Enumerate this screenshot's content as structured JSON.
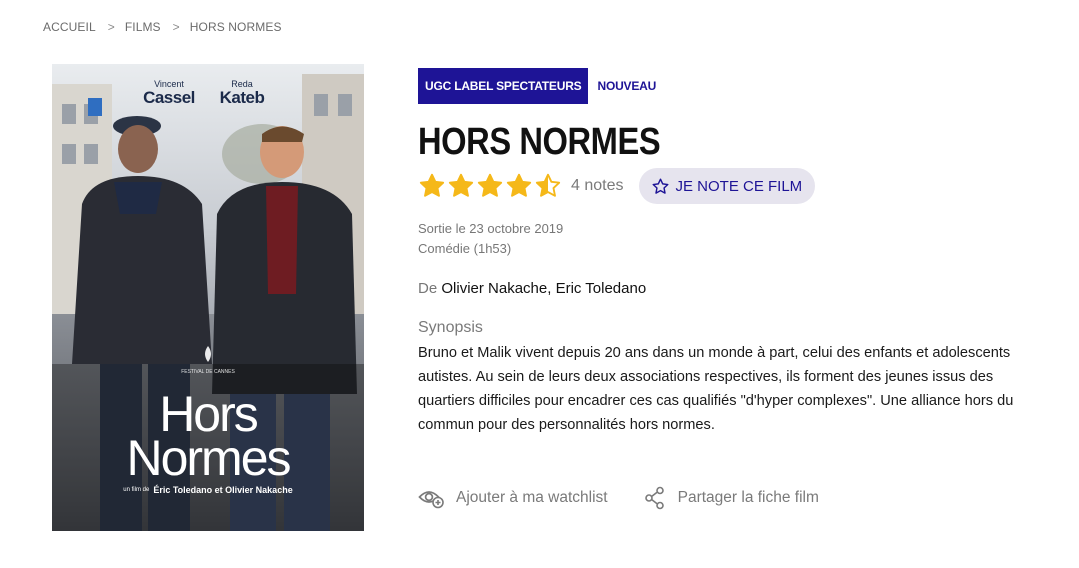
{
  "breadcrumb": {
    "items": [
      "ACCUEIL",
      "FILMS",
      "HORS NORMES"
    ],
    "separator": ">"
  },
  "poster": {
    "actor1_first": "Vincent",
    "actor1_last": "Cassel",
    "actor2_first": "Reda",
    "actor2_last": "Kateb",
    "title_line1": "Hors",
    "title_line2": "Normes",
    "festival": "FESTIVAL DE CANNES",
    "credit_prefix": "un film de",
    "credit_names": "Éric Toledano et Olivier Nakache"
  },
  "badges": {
    "label": "UGC LABEL SPECTATEURS",
    "new": "NOUVEAU"
  },
  "film": {
    "title": "HORS NORMES",
    "rating": 4.5,
    "rating_max": 5,
    "notes_count": "4 notes",
    "rate_button": "JE NOTE CE FILM",
    "release": "Sortie le 23 octobre 2019",
    "genre_duration": "Comédie (1h53)",
    "director_prefix": "De",
    "directors": "Olivier Nakache, Eric Toledano",
    "synopsis_heading": "Synopsis",
    "synopsis": "Bruno et Malik vivent depuis 20 ans dans un monde à part, celui des enfants et adolescents autistes. Au sein de leurs deux associations respectives, ils forment des jeunes issus des quartiers difficiles pour encadrer ces cas qualifiés \"d'hyper complexes\". Une alliance hors du commun pour des personnalités hors normes."
  },
  "actions": {
    "watchlist": "Ajouter à ma watchlist",
    "share": "Partager la fiche film"
  },
  "colors": {
    "brand": "#1e1496",
    "star": "#f5b819",
    "rate_button_bg": "#e6e4ee"
  },
  "icons": {
    "star": "star-icon",
    "star_half": "star-half-icon",
    "star_outline": "star-outline-icon",
    "watchlist": "eye-plus-icon",
    "share": "share-icon"
  }
}
